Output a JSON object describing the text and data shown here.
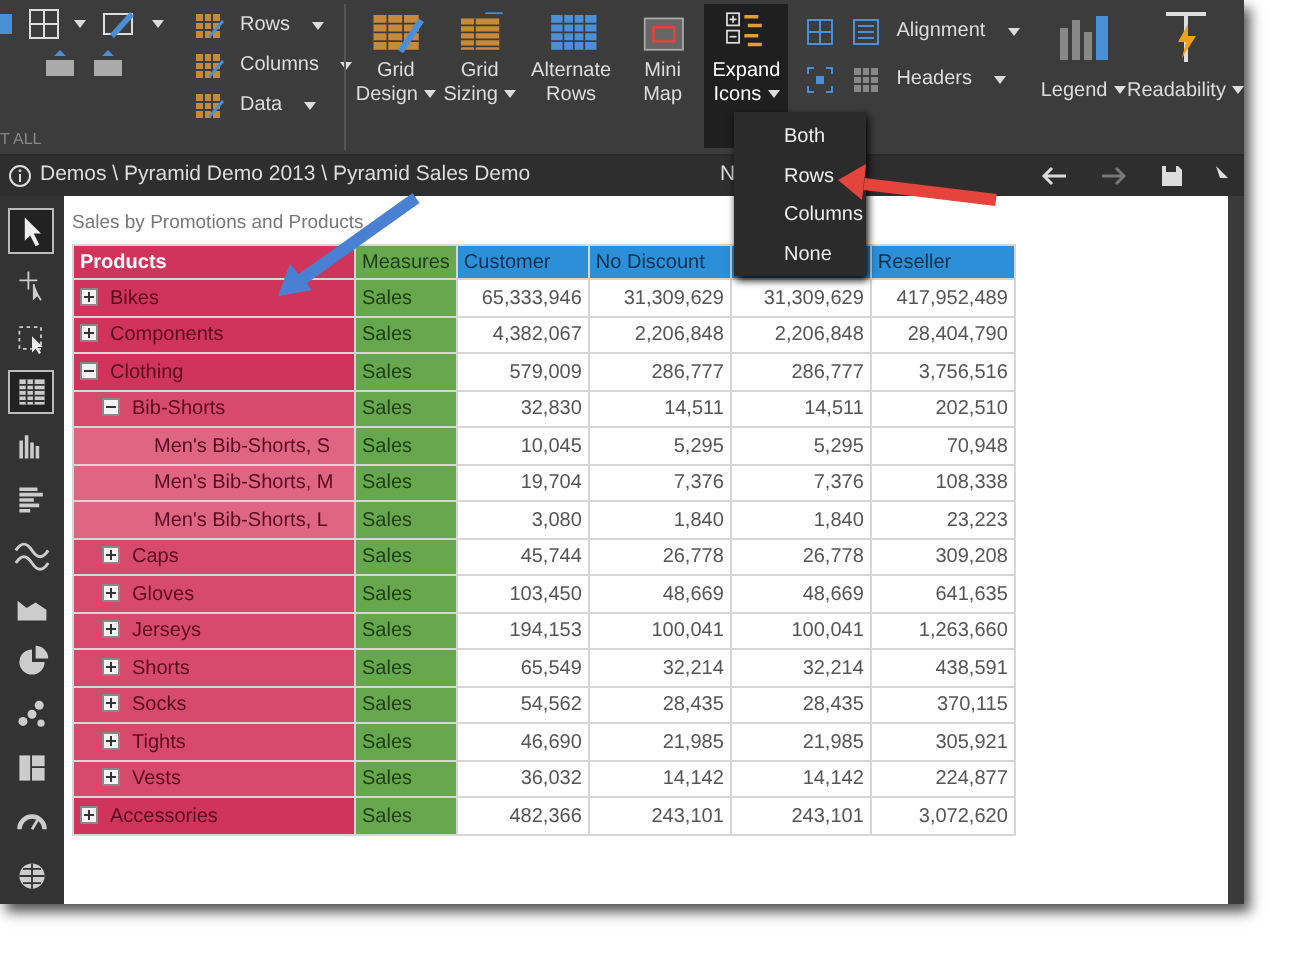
{
  "ribbon": {
    "group_label": "T ALL",
    "small_buttons": [
      {
        "label": "Rows"
      },
      {
        "label": "Columns"
      },
      {
        "label": "Data"
      }
    ],
    "large_buttons": [
      {
        "label": "Grid Design",
        "dropdown": true,
        "selected": false
      },
      {
        "label": "Grid Sizing",
        "dropdown": true,
        "selected": false
      },
      {
        "label": "Alternate Rows",
        "dropdown": false,
        "selected": false
      },
      {
        "label": "Mini Map",
        "dropdown": false,
        "selected": false
      },
      {
        "label": "Expand Icons",
        "dropdown": true,
        "selected": true
      }
    ],
    "side_buttons": [
      {
        "label": "Alignment"
      },
      {
        "label": "Headers"
      }
    ],
    "end_buttons": [
      {
        "label": "Legend"
      },
      {
        "label": "Readability"
      }
    ]
  },
  "menu": {
    "items": [
      "Both",
      "Rows",
      "Columns",
      "None"
    ]
  },
  "breadcrumb": {
    "path": "Demos \\ Pyramid Demo 2013 \\ Pyramid Sales Demo",
    "cut_text": "N"
  },
  "tools": [
    {
      "selected": true
    },
    {
      "selected": false
    },
    {
      "selected": false
    },
    {
      "selected": true
    },
    {
      "selected": false
    },
    {
      "selected": false
    },
    {
      "selected": false
    },
    {
      "selected": false
    },
    {
      "selected": false
    },
    {
      "selected": false
    },
    {
      "selected": false
    },
    {
      "selected": false
    },
    {
      "selected": false
    }
  ],
  "report": {
    "title": "Sales by Promotions and Products",
    "columns": [
      {
        "kind": "rows",
        "label": "Products"
      },
      {
        "kind": "measure",
        "label": "Measures"
      },
      {
        "kind": "value",
        "label": "Customer"
      },
      {
        "kind": "value",
        "label": "No Discount"
      },
      {
        "kind": "value"
      },
      {
        "kind": "value",
        "label": "Reseller"
      }
    ],
    "rows": [
      {
        "label": "Bikes",
        "expanded": false,
        "measure": "Sales",
        "values": [
          "65,333,946",
          "31,309,629",
          "31,309,629",
          "417,952,489"
        ]
      },
      {
        "label": "Components",
        "expanded": false,
        "measure": "Sales",
        "values": [
          "4,382,067",
          "2,206,848",
          "2,206,848",
          "28,404,790"
        ]
      },
      {
        "label": "Clothing",
        "expanded": true,
        "measure": "Sales",
        "values": [
          "579,009",
          "286,777",
          "286,777",
          "3,756,516"
        ],
        "children": [
          {
            "label": "Bib-Shorts",
            "expanded": true,
            "measure": "Sales",
            "values": [
              "32,830",
              "14,511",
              "14,511",
              "202,510"
            ],
            "children": [
              {
                "label": "Men's Bib-Shorts, S",
                "measure": "Sales",
                "values": [
                  "10,045",
                  "5,295",
                  "5,295",
                  "70,948"
                ]
              },
              {
                "label": "Men's Bib-Shorts, M",
                "measure": "Sales",
                "values": [
                  "19,704",
                  "7,376",
                  "7,376",
                  "108,338"
                ]
              },
              {
                "label": "Men's Bib-Shorts, L",
                "measure": "Sales",
                "values": [
                  "3,080",
                  "1,840",
                  "1,840",
                  "23,223"
                ]
              }
            ]
          },
          {
            "label": "Caps",
            "expanded": false,
            "measure": "Sales",
            "values": [
              "45,744",
              "26,778",
              "26,778",
              "309,208"
            ]
          },
          {
            "label": "Gloves",
            "expanded": false,
            "measure": "Sales",
            "values": [
              "103,450",
              "48,669",
              "48,669",
              "641,635"
            ]
          },
          {
            "label": "Jerseys",
            "expanded": false,
            "measure": "Sales",
            "values": [
              "194,153",
              "100,041",
              "100,041",
              "1,263,660"
            ]
          },
          {
            "label": "Shorts",
            "expanded": false,
            "measure": "Sales",
            "values": [
              "65,549",
              "32,214",
              "32,214",
              "438,591"
            ]
          },
          {
            "label": "Socks",
            "expanded": false,
            "measure": "Sales",
            "values": [
              "54,562",
              "28,435",
              "28,435",
              "370,115"
            ]
          },
          {
            "label": "Tights",
            "expanded": false,
            "measure": "Sales",
            "values": [
              "46,690",
              "21,985",
              "21,985",
              "305,921"
            ]
          },
          {
            "label": "Vests",
            "expanded": false,
            "measure": "Sales",
            "values": [
              "36,032",
              "14,142",
              "14,142",
              "224,877"
            ]
          }
        ]
      },
      {
        "label": "Accessories",
        "expanded": false,
        "measure": "Sales",
        "values": [
          "482,366",
          "243,101",
          "243,101",
          "3,072,620"
        ]
      }
    ]
  },
  "annotations": [
    {
      "color": "#4a80d4"
    },
    {
      "color": "#e5443c"
    }
  ]
}
